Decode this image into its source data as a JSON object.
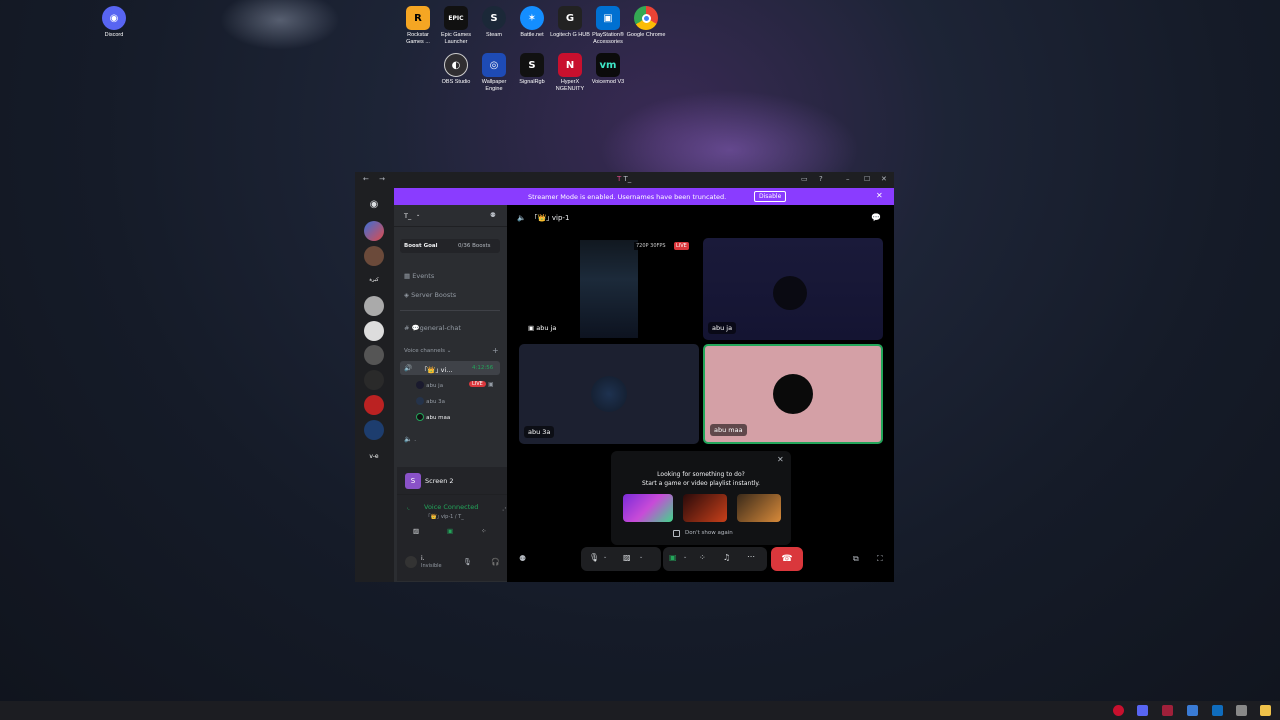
{
  "desktop": {
    "icons": [
      {
        "label": "Discord",
        "icon": "discord-icon",
        "color": "#5865f2"
      },
      {
        "label": "Rockstar Games ...",
        "icon": "rockstar-icon",
        "color": "#f5a623"
      },
      {
        "label": "Epic Games Launcher",
        "icon": "epic-games-icon",
        "color": "#111111"
      },
      {
        "label": "Steam",
        "icon": "steam-icon",
        "color": "#1b2838"
      },
      {
        "label": "Battle.net",
        "icon": "battlenet-icon",
        "color": "#148eff"
      },
      {
        "label": "Logitech G HUB",
        "icon": "logitech-icon",
        "color": "#222222"
      },
      {
        "label": "PlayStation® Accessories",
        "icon": "playstation-icon",
        "color": "#0070d1"
      },
      {
        "label": "Google Chrome",
        "icon": "chrome-icon",
        "color": "#ffffff"
      },
      {
        "label": "OBS Studio",
        "icon": "obs-icon",
        "color": "#302e31"
      },
      {
        "label": "Wallpaper Engine",
        "icon": "wallpaper-engine-icon",
        "color": "#1e4bb5"
      },
      {
        "label": "SignalRgb",
        "icon": "signalrgb-icon",
        "color": "#111111"
      },
      {
        "label": "HyperX NGENUITY",
        "icon": "hyperx-icon",
        "color": "#c8102e"
      },
      {
        "label": "Voicemod V3",
        "icon": "voicemod-icon",
        "color": "#0b0b0b"
      }
    ]
  },
  "window": {
    "title": "T_",
    "banner": {
      "message": "Streamer Mode is enabled. Usernames have been truncated.",
      "button": "Disable"
    }
  },
  "servers": [
    "كبرة",
    "v-e"
  ],
  "sidebar": {
    "server_name": "T_",
    "boost_goal_label": "Boost Goal",
    "boost_count": "0/36 Boosts",
    "events": "Events",
    "server_boosts": "Server Boosts",
    "text_channel": "💬general-chat",
    "voice_category": "Voice channels",
    "voice_channel": "｢👑｣ vi...",
    "voice_timer": "4:12:56",
    "members": [
      {
        "name": "abu ja",
        "live": "LIVE"
      },
      {
        "name": "abu 3a"
      },
      {
        "name": "abu maa"
      }
    ],
    "extra_channel": ".",
    "screen_share_label": "Screen 2",
    "voice_status": "Voice Connected",
    "voice_location": "｢👑｣ vip-1 / T_",
    "user_name": "i.",
    "user_status": "Invisible"
  },
  "call": {
    "channel_title": "｢👑｣ vip-1",
    "tiles": [
      {
        "name": "abu ja",
        "badge_res": "720P 30FPS",
        "badge_live": "LIVE"
      },
      {
        "name": "abu ja"
      },
      {
        "name": "abu 3a"
      },
      {
        "name": "abu maa"
      }
    ],
    "activity": {
      "title": "Looking for something to do?",
      "subtitle": "Start a game or video playlist instantly.",
      "checkbox": "Don't show again"
    },
    "colors": {
      "accent": "#8a3cff",
      "hangup": "#da373c",
      "speaking": "#23a55a",
      "tile_pink": "#d4a0a6"
    }
  }
}
